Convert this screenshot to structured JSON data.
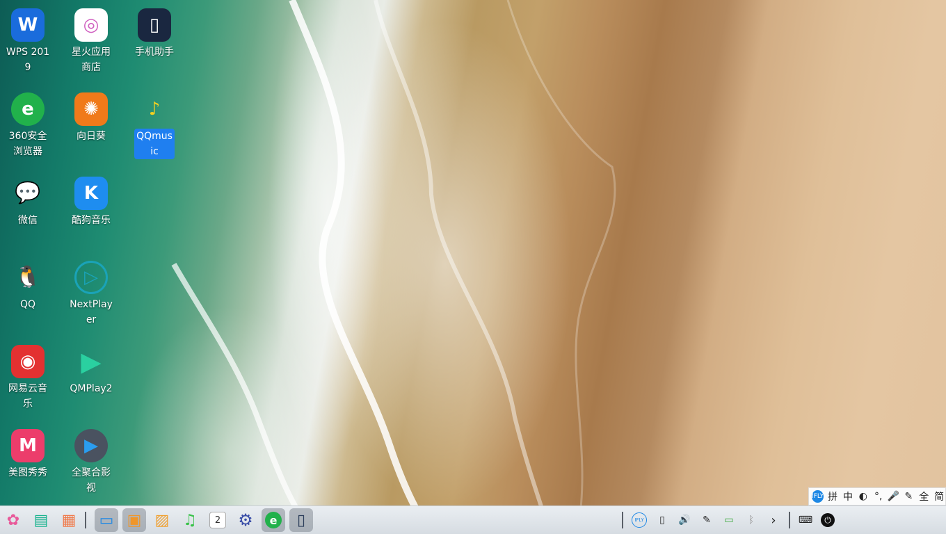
{
  "desktop": {
    "icons": [
      {
        "label": "WPS 2019",
        "glyph": "W",
        "color": "#1a6cdc"
      },
      {
        "label": "星火应用商店",
        "glyph": "◎",
        "color": "#ffffff"
      },
      {
        "label": "手机助手",
        "glyph": "▯",
        "color": "#1a2740"
      },
      {
        "label": "360安全浏览器",
        "glyph": "e",
        "color": "#21b14b"
      },
      {
        "label": "向日葵",
        "glyph": "✺",
        "color": "#f07a1a"
      },
      {
        "label": "QQmusic",
        "glyph": "♪",
        "color": "#31c27c"
      },
      {
        "label": "微信",
        "glyph": "💬",
        "color": "#3dbd3d"
      },
      {
        "label": "酷狗音乐",
        "glyph": "K",
        "color": "#1e8df0"
      },
      {
        "label": "QQ",
        "glyph": "🐧",
        "color": "#222222"
      },
      {
        "label": "NextPlayer",
        "glyph": "▷",
        "color": "#1aa3b8"
      },
      {
        "label": "网易云音乐",
        "glyph": "◉",
        "color": "#e33131"
      },
      {
        "label": "QMPlay2",
        "glyph": "▶",
        "color": "#2a3a8a"
      },
      {
        "label": "美图秀秀",
        "glyph": "M",
        "color": "#ec3d6b"
      },
      {
        "label": "全聚合影视",
        "glyph": "▶",
        "color": "#4a5260"
      }
    ]
  },
  "ime": {
    "items": [
      "拼",
      "中",
      "◐",
      "°,",
      "🎤",
      "✎",
      "全",
      "简"
    ],
    "logo_text": "IFLY"
  },
  "dock": {
    "apps": [
      {
        "name": "launcher",
        "glyph": "✿",
        "color": "#e8e8e8"
      },
      {
        "name": "multitask",
        "glyph": "▤",
        "color": "#17b38e"
      },
      {
        "name": "show-desktop",
        "glyph": "▦",
        "color": "#f07a4a"
      },
      {
        "name": "file-manager",
        "glyph": "▭",
        "color": "#1e88e5"
      },
      {
        "name": "app-store",
        "glyph": "▣",
        "color": "#f0962a"
      },
      {
        "name": "image-viewer",
        "glyph": "▨",
        "color": "#f0a030"
      },
      {
        "name": "music",
        "glyph": "♫",
        "color": "#39c24a"
      },
      {
        "name": "calendar",
        "glyph": "2",
        "color": "#ffffff"
      },
      {
        "name": "settings",
        "glyph": "⚙",
        "color": "#3a4ea8"
      },
      {
        "name": "360-browser",
        "glyph": "e",
        "color": "#21b14b"
      },
      {
        "name": "phone-assistant",
        "glyph": "▯",
        "color": "#2c3e5a"
      }
    ],
    "tray": [
      "IFLY",
      "▯",
      "🔊",
      "✎",
      "▭",
      "ᛒ",
      "›",
      "⌨",
      "⏻"
    ]
  }
}
